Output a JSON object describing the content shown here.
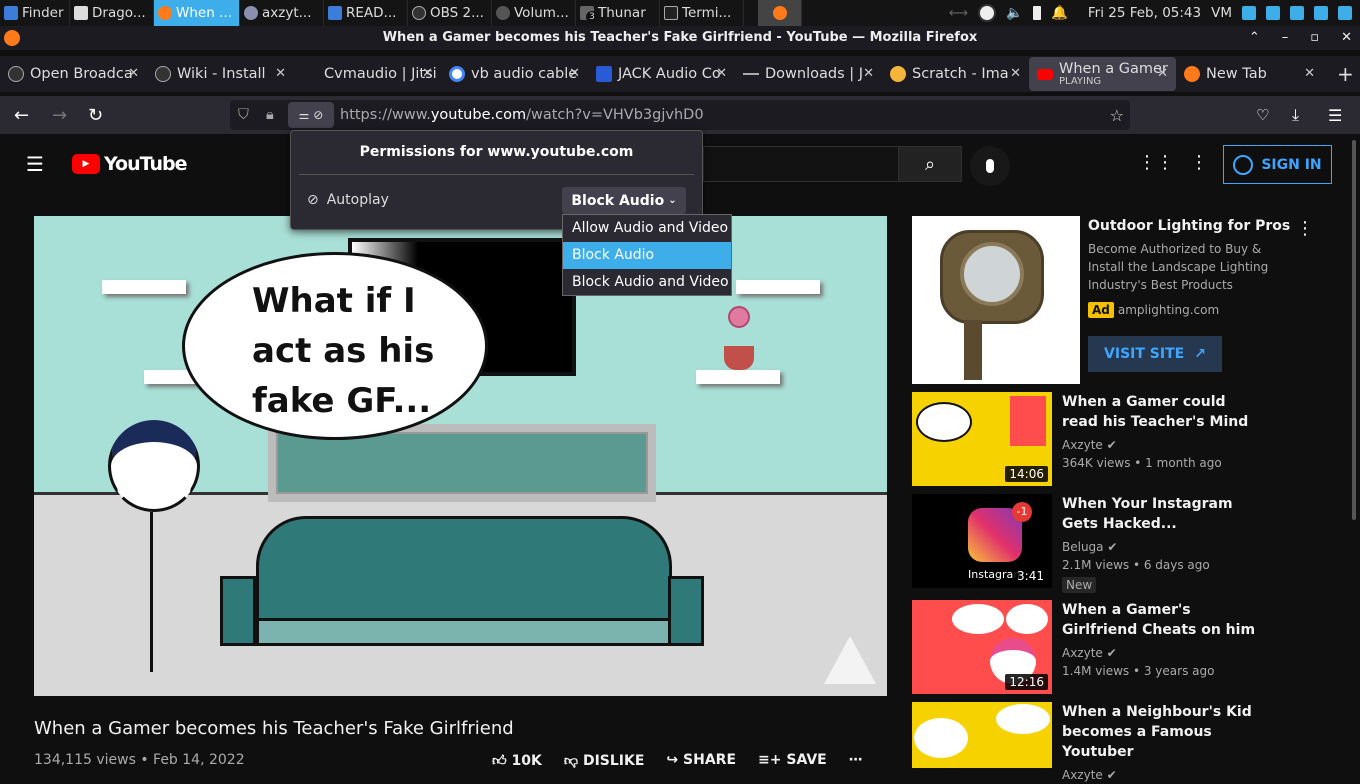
{
  "taskbar": {
    "tasks": [
      {
        "label": "Finder",
        "active": false
      },
      {
        "label": "Drago...",
        "active": false
      },
      {
        "label": "When ...",
        "active": true
      },
      {
        "label": "axzyt...",
        "active": false
      },
      {
        "label": "READ...",
        "active": false
      },
      {
        "label": "OBS 2...",
        "active": false
      },
      {
        "label": "Volum...",
        "active": false
      },
      {
        "label": "Thunar",
        "active": false
      },
      {
        "label": "Termi...",
        "active": false
      }
    ],
    "badge": "3",
    "clock": "Fri 25 Feb, 05:43",
    "user": "VM"
  },
  "window": {
    "title": "When a Gamer becomes his Teacher's Fake Girlfriend - YouTube — Mozilla Firefox"
  },
  "tabs": [
    {
      "label": "Open Broadca"
    },
    {
      "label": "Wiki - Install"
    },
    {
      "label": "Cvmaudio | Jitsi"
    },
    {
      "label": "vb audio cable"
    },
    {
      "label": "JACK Audio Co"
    },
    {
      "label": "Downloads | J"
    },
    {
      "label": "Scratch - Ima"
    },
    {
      "label": "When a Gamer",
      "sub": "PLAYING"
    },
    {
      "label": "New Tab"
    }
  ],
  "url": {
    "prefix": "https://www.",
    "domain": "youtube.com",
    "path": "/watch?v=VHVb3gjvhD0"
  },
  "youtube": {
    "logo": "YouTube",
    "signin": "SIGN IN",
    "video_title": "When a Gamer becomes his Teacher's Fake Girlfriend",
    "views": "134,115 views • Feb 14, 2022",
    "likes": "10K",
    "dislike": "DISLIKE",
    "share": "SHARE",
    "save": "SAVE",
    "speech": [
      "What if I",
      "act as his",
      "fake GF..."
    ]
  },
  "ad": {
    "title": "Outdoor Lighting for Pros",
    "desc": "Become Authorized to Buy & Install the Landscape Lighting Industry's Best Products",
    "badge": "Ad",
    "domain": "amplighting.com",
    "cta": "VISIT SITE"
  },
  "recs": [
    {
      "title": "When a Gamer could read his Teacher's Mind",
      "channel": "Axzyte",
      "meta": "364K views • 1 month ago",
      "duration": "14:06",
      "new": ""
    },
    {
      "title": "When Your Instagram Gets Hacked...",
      "channel": "Beluga",
      "meta": "2.1M views • 6 days ago",
      "duration": "3:41",
      "new": "New",
      "thumb_text": "Instagram"
    },
    {
      "title": "When a Gamer's Girlfriend Cheats on him",
      "channel": "Axzyte",
      "meta": "1.4M views • 3 years ago",
      "duration": "12:16",
      "new": ""
    },
    {
      "title": "When a Neighbour's Kid becomes a Famous Youtuber",
      "channel": "Axzyte",
      "meta": "",
      "duration": "",
      "new": ""
    }
  ],
  "permissions": {
    "heading": "Permissions for www.youtube.com",
    "setting": "Autoplay",
    "value": "Block Audio",
    "options": [
      "Allow Audio and Video",
      "Block Audio",
      "Block Audio and Video"
    ],
    "selected_index": 1
  }
}
